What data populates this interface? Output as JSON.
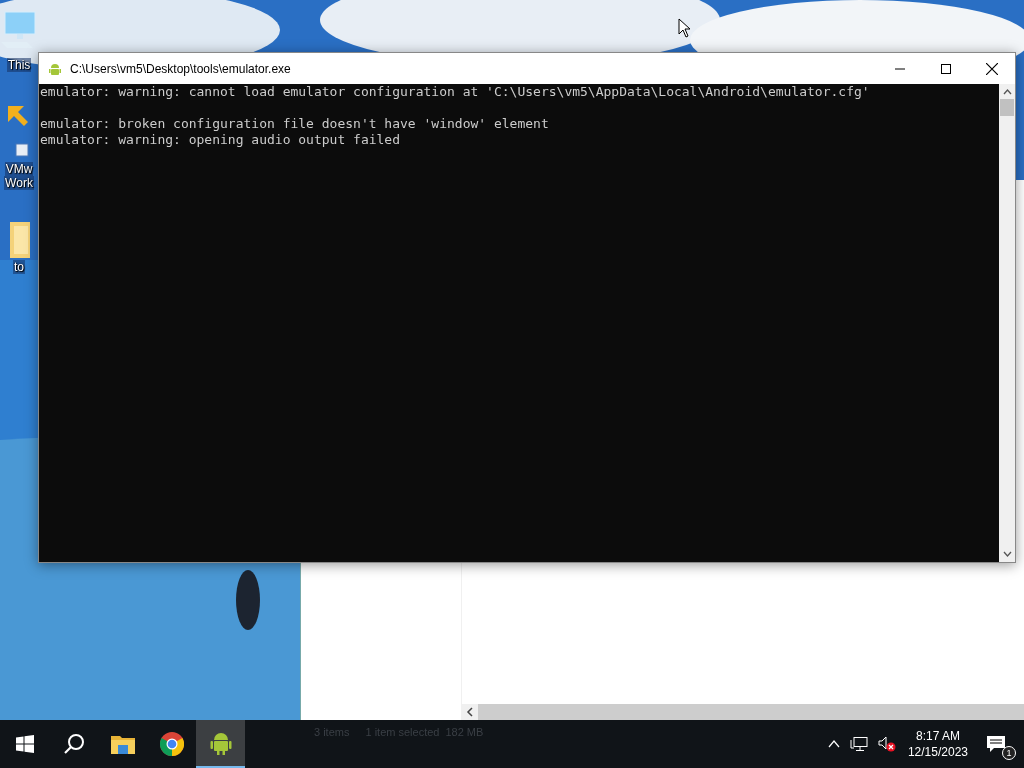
{
  "desktop": {
    "icons": [
      {
        "kind": "computer",
        "lines": [
          "This"
        ]
      },
      {
        "kind": "shortcut",
        "lines": [
          "VMw",
          "Work"
        ]
      },
      {
        "kind": "folder",
        "lines": [
          "to"
        ]
      }
    ]
  },
  "explorer": {
    "status": [
      "3 items",
      "1 item selected",
      "182 MB"
    ]
  },
  "console": {
    "title": "C:\\Users\\vm5\\Desktop\\tools\\emulator.exe",
    "blocks": [
      [
        "emulator: warning: cannot load emulator configuration at 'C:\\Users\\vm5\\AppData\\Local\\Android\\emulator.cfg'"
      ],
      [
        "emulator: broken configuration file doesn't have 'window' element",
        "emulator: warning: opening audio output failed"
      ]
    ]
  },
  "taskbar": {
    "apps": [
      {
        "kind": "start",
        "selected": false
      },
      {
        "kind": "search",
        "selected": false
      },
      {
        "kind": "explorer",
        "selected": false
      },
      {
        "kind": "chrome",
        "selected": false
      },
      {
        "kind": "android",
        "selected": true
      }
    ],
    "tray": {
      "time": "8:17 AM",
      "date": "12/15/2023",
      "sound_muted": true,
      "notifications": "1"
    }
  }
}
